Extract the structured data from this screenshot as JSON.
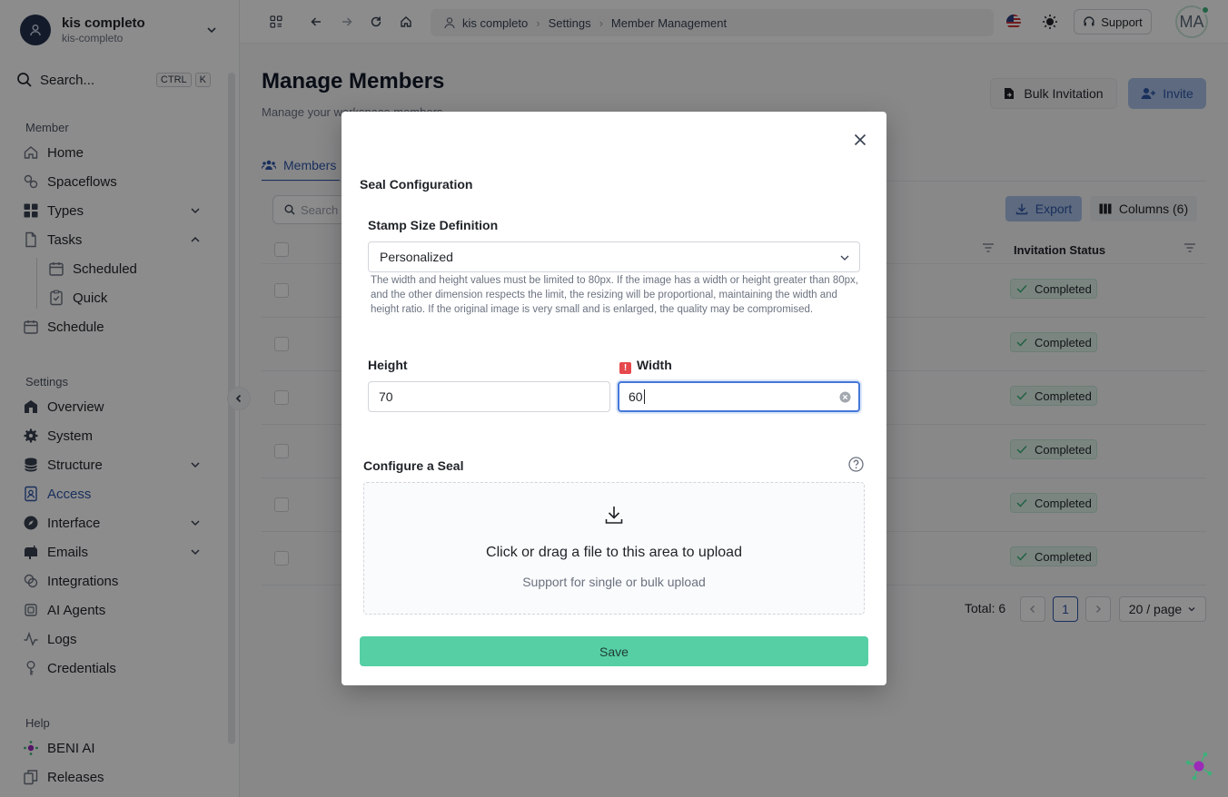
{
  "workspace": {
    "name": "kis completo",
    "slug": "kis-completo"
  },
  "search": {
    "label": "Search...",
    "kbd1": "CTRL",
    "kbd2": "K"
  },
  "sidebar": {
    "member_label": "Member",
    "member_items": [
      {
        "label": "Home"
      },
      {
        "label": "Spaceflows"
      },
      {
        "label": "Types"
      },
      {
        "label": "Tasks"
      },
      {
        "label": "Scheduled"
      },
      {
        "label": "Quick"
      },
      {
        "label": "Schedule"
      }
    ],
    "settings_label": "Settings",
    "settings_items": [
      {
        "label": "Overview"
      },
      {
        "label": "System"
      },
      {
        "label": "Structure"
      },
      {
        "label": "Access"
      },
      {
        "label": "Interface"
      },
      {
        "label": "Emails"
      },
      {
        "label": "Integrations"
      },
      {
        "label": "AI Agents"
      },
      {
        "label": "Logs"
      },
      {
        "label": "Credentials"
      }
    ],
    "help_label": "Help",
    "help_items": [
      {
        "label": "BENI AI"
      },
      {
        "label": "Releases"
      }
    ]
  },
  "topbar": {
    "breadcrumbs": [
      "kis completo",
      "Settings",
      "Member Management"
    ],
    "support_label": "Support",
    "user_initials": "MA"
  },
  "page": {
    "title": "Manage Members",
    "subtitle": "Manage your workspace members",
    "bulk_label": "Bulk Invitation",
    "invite_label": "Invite",
    "tab_members": "Members",
    "search_placeholder": "Search",
    "export_label": "Export",
    "columns_label": "Columns (6)",
    "col_invitation_status": "Invitation Status",
    "rows": [
      {
        "status": "Completed"
      },
      {
        "status": "Completed"
      },
      {
        "status": "Completed"
      },
      {
        "status": "Completed"
      },
      {
        "status": "Completed"
      },
      {
        "status": "Completed"
      }
    ],
    "total": "Total: 6",
    "page_num": "1",
    "page_size": "20 / page"
  },
  "modal": {
    "title": "Seal Configuration",
    "stamp_label": "Stamp Size Definition",
    "stamp_value": "Personalized",
    "help_text": "The width and height values must be limited to 80px. If the image has a width or height greater than 80px, and the other dimension respects the limit, the resizing will be proportional, maintaining the width and height ratio. If the original image is very small and is enlarged, the quality may be compromised.",
    "height_label": "Height",
    "height_value": "70",
    "width_label": "Width",
    "width_value": "60",
    "seal_label": "Configure a Seal",
    "upload_text": "Click or drag a file to this area to upload",
    "upload_hint": "Support for single or bulk upload",
    "save_label": "Save"
  }
}
